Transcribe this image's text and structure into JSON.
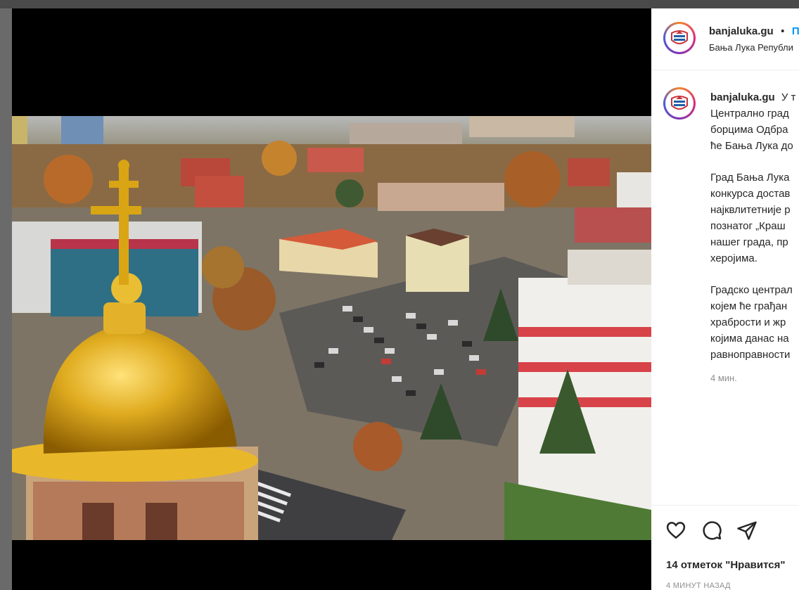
{
  "post": {
    "header": {
      "username": "banjaluka.gu",
      "separator": "•",
      "follow_label": "П",
      "location": "Бања Лука Републи"
    },
    "caption": {
      "username": "banjaluka.gu",
      "first_line_start": "У т",
      "paragraph1_lines": [
        "Централно град",
        "борцима Одбра",
        "ће Бања Лука до"
      ],
      "paragraph2_lines": [
        "Град Бања Лука",
        "конкурса достав",
        "најквлитетније р",
        "познатог „Краш",
        "нашег града, пр",
        "херојима."
      ],
      "paragraph3_lines": [
        "Градско централ",
        "којем ће грађан",
        "храбрости и жр",
        "којима данас на",
        "равноправности"
      ]
    },
    "time_ago": "4 мин.",
    "likes": "14 отметок \"Нравится\"",
    "posted": "4 МИНУТ НАЗАД"
  },
  "icons": [
    "avatar-logo-icon",
    "heart-icon",
    "comment-icon",
    "share-icon",
    "cross-icon"
  ],
  "colors": {
    "follow": "#0095f6",
    "muted": "#8e8e8e",
    "text": "#262626",
    "dome": "#d9a514"
  }
}
